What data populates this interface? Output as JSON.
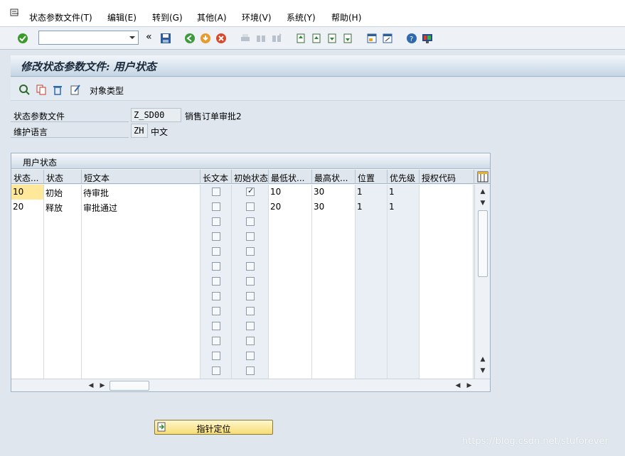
{
  "menu": {
    "items": [
      "状态参数文件(T)",
      "编辑(E)",
      "转到(G)",
      "其他(A)",
      "环境(V)",
      "系统(Y)",
      "帮助(H)"
    ]
  },
  "toolbar": {
    "command_value": "",
    "nav_back_glyph": "«"
  },
  "title": "修改状态参数文件: 用户状态",
  "app_toolbar": {
    "object_type_label": "对象类型"
  },
  "fields": {
    "profile": {
      "label": "状态参数文件",
      "value": "Z_SD00",
      "desc": "销售订单审批2"
    },
    "language": {
      "label": "维护语言",
      "value": "ZH",
      "desc": "中文"
    }
  },
  "table": {
    "title": "用户状态",
    "columns": [
      "状态...",
      "状态",
      "短文本",
      "长文本",
      "初始状态",
      "最低状...",
      "最高状...",
      "位置",
      "优先级",
      "授权代码"
    ],
    "rows": [
      {
        "num": "10",
        "status": "初始",
        "short": "待审批",
        "long": false,
        "initial": true,
        "low": "10",
        "high": "30",
        "pos": "1",
        "prio": "1",
        "auth": ""
      },
      {
        "num": "20",
        "status": "释放",
        "short": "审批通过",
        "long": false,
        "initial": false,
        "low": "20",
        "high": "30",
        "pos": "1",
        "prio": "1",
        "auth": ""
      }
    ],
    "empty_rows": 11
  },
  "bottom_button": {
    "label": "指针定位"
  },
  "watermark": "https://blog.csdn.net/stuforever",
  "colors": {
    "accent": "#f6dd74",
    "title_band": "#c5d5e4",
    "highlight": "#ffe89a"
  }
}
